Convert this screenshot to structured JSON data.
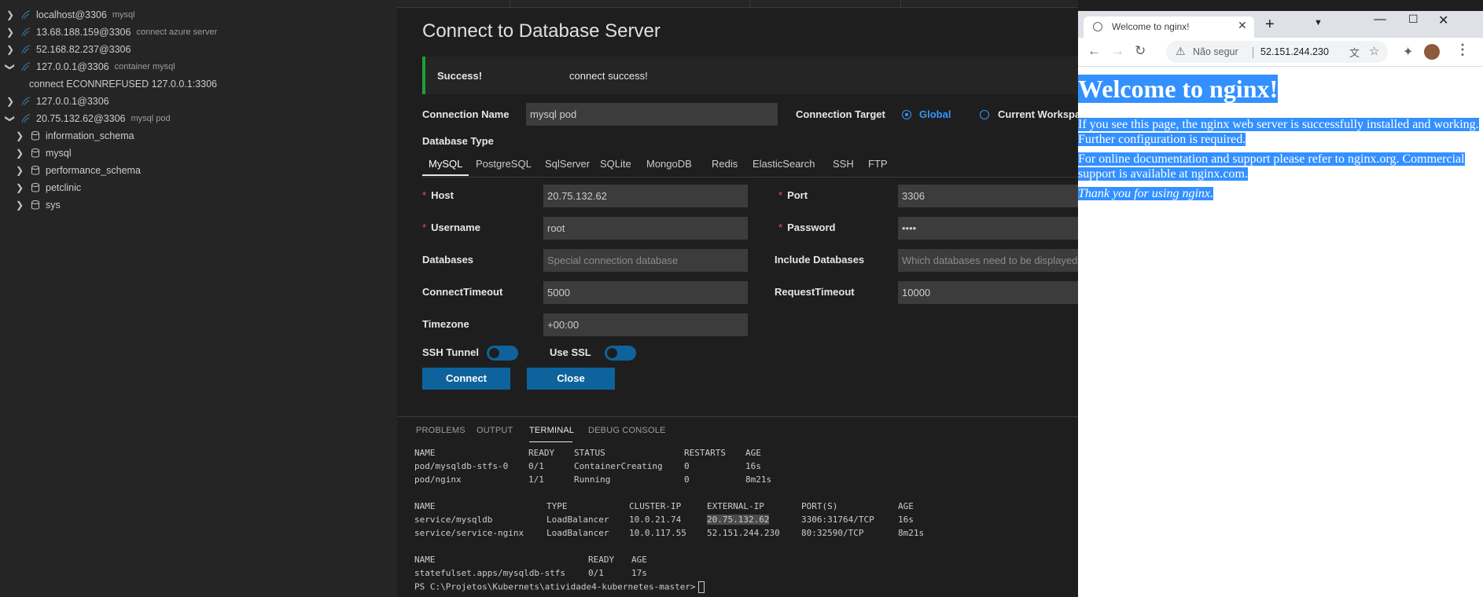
{
  "tree": {
    "connections": [
      {
        "name": "localhost@3306",
        "desc": "mysql",
        "expanded": false
      },
      {
        "name": "13.68.188.159@3306",
        "desc": "connect azure server",
        "expanded": false
      },
      {
        "name": "52.168.82.237@3306",
        "desc": "",
        "expanded": false
      },
      {
        "name": "127.0.0.1@3306",
        "desc": "container mysql",
        "expanded": true
      },
      {
        "name": "127.0.0.1@3306",
        "desc": "",
        "expanded": false
      },
      {
        "name": "20.75.132.62@3306",
        "desc": "mysql pod",
        "expanded": true
      }
    ],
    "error_message": "connect ECONNREFUSED 127.0.0.1:3306",
    "databases": [
      "information_schema",
      "mysql",
      "performance_schema",
      "petclinic",
      "sys"
    ]
  },
  "form": {
    "title": "Connect to Database Server",
    "success_label": "Success!",
    "success_message": "connect success!",
    "connection_name_label": "Connection Name",
    "connection_name_value": "mysql pod",
    "connection_target_label": "Connection Target",
    "target_global": "Global",
    "target_current": "Current Workspace",
    "database_type_label": "Database Type",
    "db_types": [
      "MySQL",
      "PostgreSQL",
      "SqlServer",
      "SQLite",
      "MongoDB",
      "Redis",
      "ElasticSearch",
      "SSH",
      "FTP"
    ],
    "host_label": "Host",
    "host_value": "20.75.132.62",
    "port_label": "Port",
    "port_value": "3306",
    "username_label": "Username",
    "username_value": "root",
    "password_label": "Password",
    "password_value": "••••",
    "databases_label": "Databases",
    "databases_placeholder": "Special connection database",
    "include_databases_label": "Include Databases",
    "include_databases_placeholder": "Which databases need to be displayed",
    "connect_timeout_label": "ConnectTimeout",
    "connect_timeout_value": "5000",
    "request_timeout_label": "RequestTimeout",
    "request_timeout_value": "10000",
    "timezone_label": "Timezone",
    "timezone_value": "+00:00",
    "ssh_tunnel_label": "SSH Tunnel",
    "use_ssl_label": "Use SSL",
    "connect_button": "Connect",
    "close_button": "Close"
  },
  "panel": {
    "tabs": [
      "PROBLEMS",
      "OUTPUT",
      "TERMINAL",
      "DEBUG CONSOLE"
    ],
    "active_tab": "TERMINAL",
    "pods": {
      "headers": [
        "NAME",
        "READY",
        "STATUS",
        "RESTARTS",
        "AGE"
      ],
      "rows": [
        [
          "pod/mysqldb-stfs-0",
          "0/1",
          "ContainerCreating",
          "0",
          "16s"
        ],
        [
          "pod/nginx",
          "1/1",
          "Running",
          "0",
          "8m21s"
        ]
      ]
    },
    "services": {
      "headers": [
        "NAME",
        "TYPE",
        "CLUSTER-IP",
        "EXTERNAL-IP",
        "PORT(S)",
        "AGE"
      ],
      "rows": [
        [
          "service/mysqldb",
          "LoadBalancer",
          "10.0.21.74",
          "20.75.132.62",
          "3306:31764/TCP",
          "16s"
        ],
        [
          "service/service-nginx",
          "LoadBalancer",
          "10.0.117.55",
          "52.151.244.230",
          "80:32590/TCP",
          "8m21s"
        ]
      ]
    },
    "statefulsets": {
      "headers": [
        "NAME",
        "READY",
        "AGE"
      ],
      "rows": [
        [
          "statefulset.apps/mysqldb-stfs",
          "0/1",
          "17s"
        ]
      ]
    },
    "prompt": "PS C:\\Projetos\\Kubernets\\atividade4-kubernetes-master>"
  },
  "browser": {
    "tab_title": "Welcome to nginx!",
    "security_label": "Não segur",
    "url": "52.151.244.230",
    "heading": "Welcome to nginx!",
    "p1": "If you see this page, the nginx web server is successfully installed and working. Further configuration is required.",
    "p2": "For online documentation and support please refer to nginx.org. Commercial support is available at nginx.com.",
    "p3": "Thank you for using nginx."
  },
  "colors": {
    "accent": "#0e639c",
    "success": "#1f9e36",
    "selection": "#3390ff",
    "required": "#f14c4c",
    "radio": "#3794ff"
  }
}
